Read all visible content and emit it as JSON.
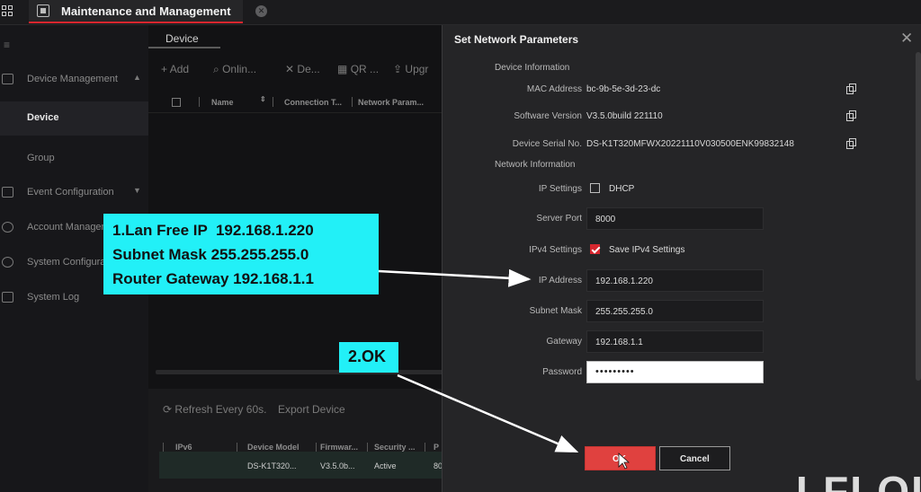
{
  "app": {
    "tab_title": "Maintenance and Management"
  },
  "sidebar": {
    "items": [
      {
        "label": "Device Management"
      },
      {
        "label": "Device"
      },
      {
        "label": "Group"
      },
      {
        "label": "Event Configuration"
      },
      {
        "label": "Account Managem"
      },
      {
        "label": "System Configura"
      },
      {
        "label": "System Log"
      }
    ]
  },
  "main": {
    "tab": "Device",
    "toolbar": [
      "Add",
      "Onlin...",
      "De...",
      "QR ...",
      "Upgr"
    ],
    "columns": [
      "Name",
      "Connection T...",
      "Network Param..."
    ],
    "bottom": {
      "refresh": "Refresh Every 60s.",
      "export": "Export Device",
      "columns": [
        "IPv6",
        "Device Model",
        "Firmwar...",
        "Security ...",
        "P"
      ],
      "row": [
        "DS-K1T320...",
        "V3.5.0b...",
        "Active",
        "80"
      ]
    }
  },
  "dialog": {
    "title": "Set Network Parameters",
    "device_info_title": "Device Information",
    "mac_label": "MAC Address",
    "mac_value": "bc-9b-5e-3d-23-dc",
    "sw_label": "Software Version",
    "sw_value": "V3.5.0build 221110",
    "serial_label": "Device Serial No.",
    "serial_value": "DS-K1T320MFWX20221110V030500ENK99832148",
    "net_info_title": "Network Information",
    "ip_settings_label": "IP Settings",
    "dhcp_label": "DHCP",
    "server_port_label": "Server Port",
    "server_port_value": "8000",
    "ipv4_label": "IPv4 Settings",
    "save_ipv4_label": "Save IPv4 Settings",
    "ip_label": "IP Address",
    "ip_value": "192.168.1.220",
    "mask_label": "Subnet Mask",
    "mask_value": "255.255.255.0",
    "gw_label": "Gateway",
    "gw_value": "192.168.1.1",
    "pw_label": "Password",
    "pw_value": "•••••••••",
    "ok_label": "OK",
    "cancel_label": "Cancel"
  },
  "annotations": {
    "step1_line1": "1.Lan Free IP  192.168.1.220",
    "step1_line2": "Subnet Mask 255.255.255.0",
    "step1_line3": "Router Gateway 192.168.1.1",
    "step2": "2.OK",
    "color": "#22f0f7"
  },
  "watermark": "LFLOI",
  "colors": {
    "accent": "#d7262e",
    "ok_button": "#e0413f"
  }
}
